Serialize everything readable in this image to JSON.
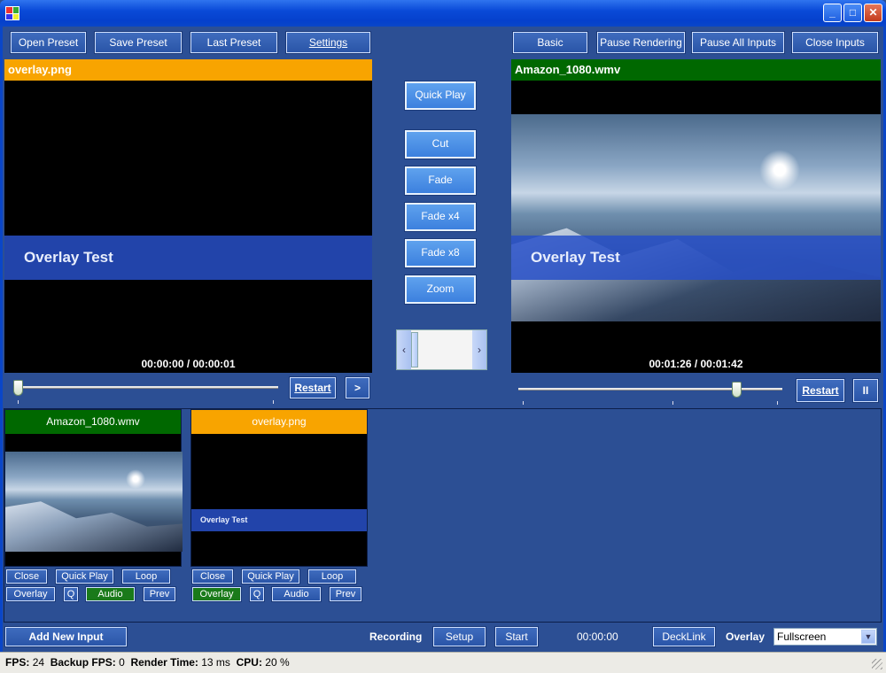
{
  "toolbar": {
    "open_preset": "Open Preset",
    "save_preset": "Save Preset",
    "last_preset": "Last Preset",
    "settings": "Settings",
    "basic": "Basic",
    "pause_rendering": "Pause Rendering",
    "pause_all_inputs": "Pause All Inputs",
    "close_inputs": "Close Inputs"
  },
  "preview": {
    "title": "overlay.png",
    "overlay_text": "Overlay Test",
    "timecode": "00:00:00 / 00:00:01",
    "restart": "Restart",
    "play": ">"
  },
  "output": {
    "title": "Amazon_1080.wmv",
    "overlay_text": "Overlay Test",
    "timecode": "00:01:26 / 00:01:42",
    "restart": "Restart",
    "pause": "II"
  },
  "transitions": {
    "quick_play": "Quick Play",
    "cut": "Cut",
    "fade": "Fade",
    "fade_x4": "Fade x4",
    "fade_x8": "Fade x8",
    "zoom": "Zoom"
  },
  "inputs": [
    {
      "title": "Amazon_1080.wmv",
      "close": "Close",
      "quick_play": "Quick Play",
      "loop": "Loop",
      "overlay": "Overlay",
      "q": "Q",
      "audio": "Audio",
      "prev": "Prev"
    },
    {
      "title": "overlay.png",
      "overlay_text": "Overlay Test",
      "close": "Close",
      "quick_play": "Quick Play",
      "loop": "Loop",
      "overlay": "Overlay",
      "q": "Q",
      "audio": "Audio",
      "prev": "Prev"
    }
  ],
  "bottom": {
    "add_new_input": "Add New Input",
    "recording_label": "Recording",
    "setup": "Setup",
    "start": "Start",
    "record_time": "00:00:00",
    "decklink": "DeckLink",
    "overlay_label": "Overlay",
    "overlay_mode": "Fullscreen"
  },
  "status": {
    "fps_label": "FPS:",
    "fps": "24",
    "backup_fps_label": "Backup FPS:",
    "backup_fps": "0",
    "render_time_label": "Render Time:",
    "render_time": "13 ms",
    "cpu_label": "CPU:",
    "cpu": "20 %"
  },
  "colors": {
    "background": "#2c4f94",
    "orange_header": "#f8a400",
    "green_header": "#006800",
    "overlay_band": "#2850c8"
  },
  "slider_positions": {
    "preview": 0.0,
    "output": 0.84
  }
}
